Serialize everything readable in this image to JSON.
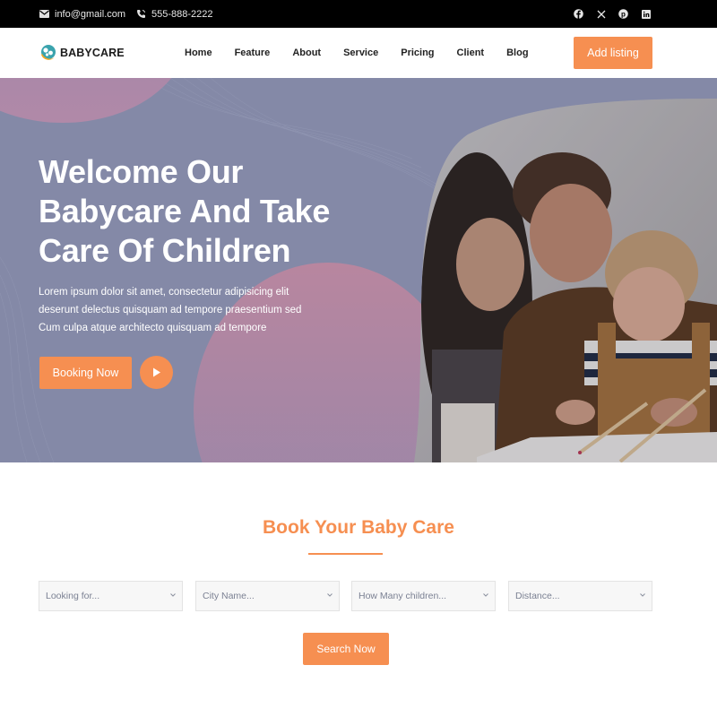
{
  "topbar": {
    "email": "info@gmail.com",
    "phone": "555-888-2222",
    "email_icon": "envelope-icon",
    "phone_icon": "phone-icon",
    "socials": [
      "facebook-icon",
      "x-twitter-icon",
      "pinterest-icon",
      "linkedin-icon"
    ]
  },
  "navbar": {
    "logo_text": "BABYCARE",
    "items": [
      {
        "label": "Home"
      },
      {
        "label": "Feature"
      },
      {
        "label": "About"
      },
      {
        "label": "Service"
      },
      {
        "label": "Pricing"
      },
      {
        "label": "Client"
      },
      {
        "label": "Blog"
      }
    ],
    "cta_label": "Add listing"
  },
  "hero": {
    "title_lines": [
      "Welcome Our",
      "Babycare And Take",
      "Care Of Children"
    ],
    "description_lines": [
      "Lorem ipsum dolor sit amet, consectetur adipisicing elit",
      "deserunt delectus quisquam ad tempore praesentium sed",
      "Cum culpa atque architecto quisquam ad tempore"
    ],
    "booking_label": "Booking Now",
    "play_icon": "play-icon",
    "image_alt": "Family with child drawing with colored pencils"
  },
  "booking": {
    "title": "Book Your Baby Care",
    "selects": [
      {
        "value": "Looking for..."
      },
      {
        "value": "City Name..."
      },
      {
        "value": "How Many children..."
      },
      {
        "value": "Distance..."
      }
    ],
    "search_label": "Search Now"
  },
  "colors": {
    "accent": "#f68f51",
    "hero_bg": "#8489a7",
    "topbar_bg": "#000000"
  }
}
